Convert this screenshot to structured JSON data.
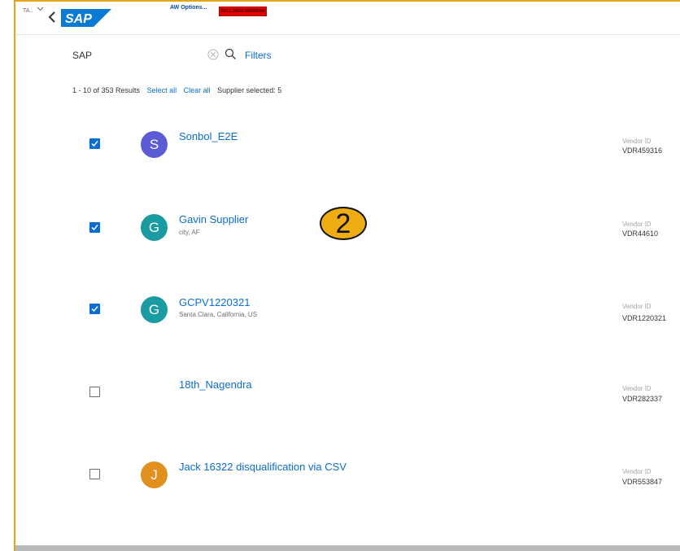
{
  "shell": {
    "ta_label": "TA..",
    "aw_options": "AW Options...",
    "full_refresh": "FULL PAGE REFRESH"
  },
  "search": {
    "value": "SAP",
    "filters_label": "Filters"
  },
  "results": {
    "range": "1 - 10 of 353 Results",
    "select_all": "Select all",
    "clear_all": "Clear all",
    "selected": "Supplier selected: 5"
  },
  "suppliers": [
    {
      "initial": "S",
      "avatar_color": "#5b5bd6",
      "name": "Sonbol_E2E",
      "location": "",
      "vendor_label": "Vendor ID",
      "vendor_id": "VDR459316",
      "checked": true
    },
    {
      "initial": "G",
      "avatar_color": "#1a9ba1",
      "name": "Gavin Supplier",
      "location": "city, AF",
      "vendor_label": "Vendor ID",
      "vendor_id": "VDR44610",
      "checked": true
    },
    {
      "initial": "G",
      "avatar_color": "#1a9ba1",
      "name": "GCPV1220321",
      "location": "Santa Clara, California, US",
      "vendor_label": "Vendor ID",
      "vendor_id": "VDR1220321",
      "checked": true
    },
    {
      "initial": "",
      "avatar_color": "",
      "name": "18th_Nagendra",
      "location": "",
      "vendor_label": "Vendor ID",
      "vendor_id": "VDR282337",
      "checked": false
    },
    {
      "initial": "J",
      "avatar_color": "#e2901d",
      "name": "Jack 16322 disqualification via CSV",
      "location": "",
      "vendor_label": "Vendor ID",
      "vendor_id": "VDR553847",
      "checked": false
    }
  ],
  "step_badge": "2",
  "colors": {
    "accent": "#0a6ed1",
    "highlight": "#e8a413"
  }
}
